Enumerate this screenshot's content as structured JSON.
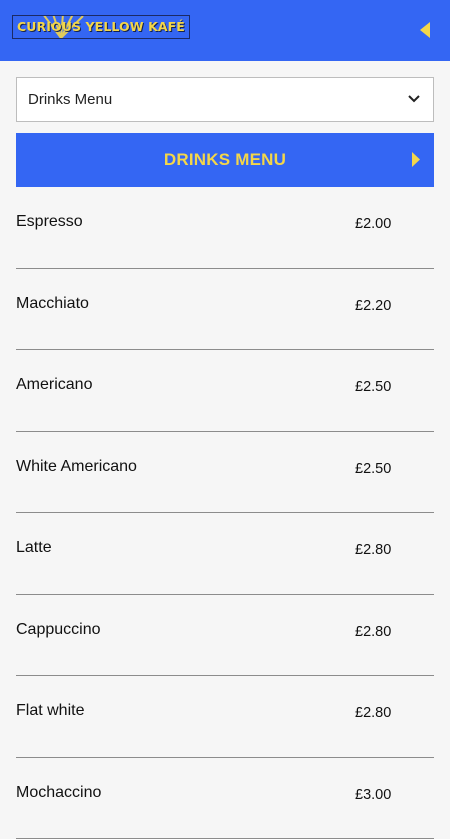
{
  "header": {
    "brand": "CURIOUS YELLOW KAFÉ",
    "back_icon": "triangle-left-icon",
    "colors": {
      "bar": "#3466f3",
      "accent": "#f3d64a"
    }
  },
  "menu_select": {
    "value": "Drinks Menu",
    "icon": "chevron-down-icon"
  },
  "section": {
    "title": "DRINKS MENU",
    "icon": "triangle-right-icon"
  },
  "items": [
    {
      "name": "Espresso",
      "price": "£2.00"
    },
    {
      "name": "Macchiato",
      "price": "£2.20"
    },
    {
      "name": "Americano",
      "price": "£2.50"
    },
    {
      "name": "White Americano",
      "price": "£2.50"
    },
    {
      "name": "Latte",
      "price": "£2.80"
    },
    {
      "name": "Cappuccino",
      "price": "£2.80"
    },
    {
      "name": "Flat white",
      "price": "£2.80"
    },
    {
      "name": "Mochaccino",
      "price": "£3.00"
    }
  ]
}
